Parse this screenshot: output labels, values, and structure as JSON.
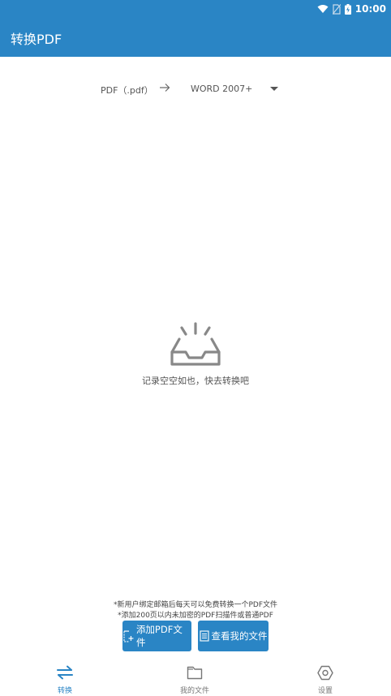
{
  "status_bar": {
    "time": "10:00"
  },
  "app_bar": {
    "title": "转换PDF"
  },
  "conversion": {
    "from_format": "PDF（.pdf）",
    "to_format": "WORD 2007+"
  },
  "empty_state": {
    "message": "记录空空如也，快去转换吧"
  },
  "notices": [
    "*新用户绑定邮箱后每天可以免费转换一个PDF文件",
    "*添加200页以内未加密的PDF扫描件或普通PDF"
  ],
  "buttons": {
    "add_pdf": "添加PDF文件",
    "view_files": "查看我的文件"
  },
  "bottom_nav": {
    "items": [
      {
        "label": "转换",
        "icon": "swap-arrows-icon",
        "active": true
      },
      {
        "label": "我的文件",
        "icon": "folder-icon",
        "active": false
      },
      {
        "label": "设置",
        "icon": "settings-hexagon-icon",
        "active": false
      }
    ]
  },
  "colors": {
    "primary": "#2a85c5",
    "nav_inactive": "#777777",
    "icon_gray": "#888888"
  }
}
